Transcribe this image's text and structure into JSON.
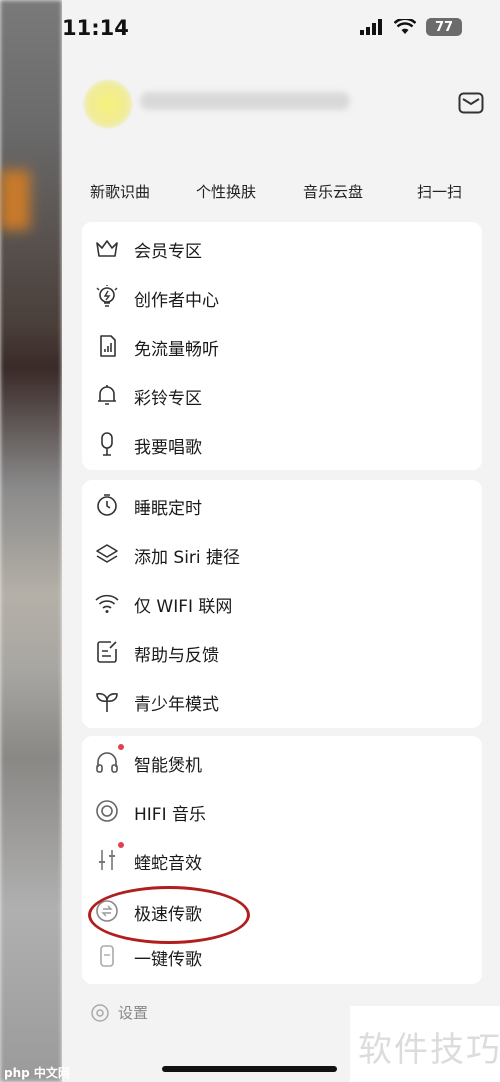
{
  "status": {
    "time": "11:14",
    "battery": "77"
  },
  "shortcuts": [
    "新歌识曲",
    "个性换肤",
    "音乐云盘",
    "扫一扫"
  ],
  "group1": [
    {
      "label": "会员专区",
      "icon": "crown-icon"
    },
    {
      "label": "创作者中心",
      "icon": "lightbulb-icon"
    },
    {
      "label": "免流量畅听",
      "icon": "sim-card-icon"
    },
    {
      "label": "彩铃专区",
      "icon": "bell-icon"
    },
    {
      "label": "我要唱歌",
      "icon": "microphone-icon"
    }
  ],
  "group2": [
    {
      "label": "睡眠定时",
      "icon": "timer-icon"
    },
    {
      "label": "添加 Siri 捷径",
      "icon": "layers-icon"
    },
    {
      "label": "仅 WIFI 联网",
      "icon": "wifi-icon"
    },
    {
      "label": "帮助与反馈",
      "icon": "feedback-icon"
    },
    {
      "label": "青少年模式",
      "icon": "sprout-icon"
    }
  ],
  "group3": [
    {
      "label": "智能煲机",
      "icon": "headphones-icon",
      "badge": true
    },
    {
      "label": "HIFI 音乐",
      "icon": "disc-icon",
      "badge": false
    },
    {
      "label": "蝰蛇音效",
      "icon": "equalizer-icon",
      "badge": true
    },
    {
      "label": "极速传歌",
      "icon": "transfer-icon",
      "badge": false
    },
    {
      "label": "一键传歌",
      "icon": "phone-transfer-icon",
      "badge": false
    }
  ],
  "settings_label": "设置",
  "watermark": "软件技巧",
  "logo_text": "php 中文网",
  "colors": {
    "annotation": "#b01e1e",
    "badge": "#e04050"
  }
}
